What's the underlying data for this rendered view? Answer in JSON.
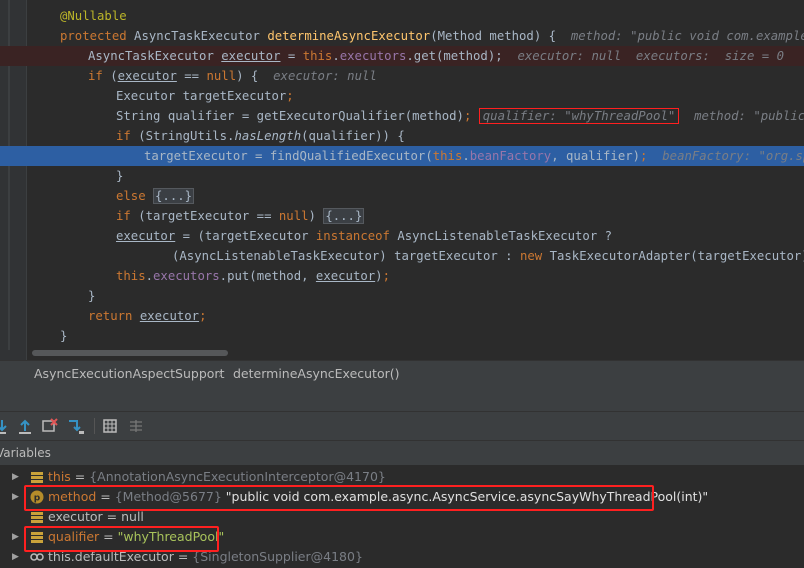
{
  "editor": {
    "lines": [
      {
        "parts": [
          {
            "t": "@Nullable",
            "c": "ann"
          }
        ]
      },
      {
        "parts": [
          {
            "t": "protected ",
            "c": "kw"
          },
          {
            "t": "AsyncTaskExecutor "
          },
          {
            "t": "determineAsyncExecutor",
            "c": "fn"
          },
          {
            "t": "(Method method) {  "
          },
          {
            "t": "method: \"public void com.example.async.AsyncService.asyncSayWhyThreadPool(int)\"",
            "c": "inlay"
          }
        ]
      },
      {
        "parts": [
          {
            "t": "AsyncTaskExecutor "
          },
          {
            "t": "executor",
            "c": "var-ul"
          },
          {
            "t": " = "
          },
          {
            "t": "this",
            "c": "kw"
          },
          {
            "t": "."
          },
          {
            "t": "executors",
            "c": "field"
          },
          {
            "t": ".get(method);  "
          },
          {
            "t": "executor: null  executors:  size = 0",
            "c": "inlay"
          }
        ]
      },
      {
        "parts": [
          {
            "t": "if ",
            "c": "kw"
          },
          {
            "t": "("
          },
          {
            "t": "executor",
            "c": "var-ul"
          },
          {
            "t": " == "
          },
          {
            "t": "null",
            "c": "kw"
          },
          {
            "t": ") {  "
          },
          {
            "t": "executor: null",
            "c": "inlay"
          }
        ]
      },
      {
        "parts": [
          {
            "t": "Executor targetExecutor"
          },
          {
            "t": ";",
            "c": "kw"
          }
        ]
      },
      {
        "parts": [
          {
            "t": "String qualifier = getExecutorQualifier(method)"
          },
          {
            "t": ";",
            "c": "kw"
          },
          {
            "t": " "
          },
          {
            "t": "qualifier: \"whyThreadPool\"",
            "c": "inlay boxed"
          },
          {
            "t": "  "
          },
          {
            "t": "method: \"public void com.example.async.AsyncService.asyncSayWhyThreadPool(int)\"",
            "c": "inlay"
          }
        ]
      },
      {
        "parts": [
          {
            "t": "if ",
            "c": "kw"
          },
          {
            "t": "(StringUtils."
          },
          {
            "t": "hasLength",
            "c": "static-i"
          },
          {
            "t": "(qualifier)) {"
          }
        ]
      },
      {
        "parts": [
          {
            "t": "targetExecutor = findQualifiedExecutor("
          },
          {
            "t": "this",
            "c": "kw"
          },
          {
            "t": "."
          },
          {
            "t": "beanFactory",
            "c": "field"
          },
          {
            "t": ", qualifier)"
          },
          {
            "t": ";",
            "c": "kw"
          },
          {
            "t": "  "
          },
          {
            "t": "beanFactory: \"org.springframework.beans.factory.support.DefaultListableBeanFactory\"",
            "c": "inlay"
          }
        ]
      },
      {
        "parts": [
          {
            "t": "}"
          }
        ]
      },
      {
        "parts": [
          {
            "t": "else ",
            "c": "kw"
          },
          {
            "t": "{...}",
            "c": "fold"
          }
        ]
      },
      {
        "parts": [
          {
            "t": "if ",
            "c": "kw"
          },
          {
            "t": "(targetExecutor == "
          },
          {
            "t": "null",
            "c": "kw"
          },
          {
            "t": ") "
          },
          {
            "t": "{...}",
            "c": "fold"
          }
        ]
      },
      {
        "parts": [
          {
            "t": "executor",
            "c": "var-ul"
          },
          {
            "t": " = (targetExecutor "
          },
          {
            "t": "instanceof ",
            "c": "kw"
          },
          {
            "t": "AsyncListenableTaskExecutor ?"
          }
        ]
      },
      {
        "parts": [
          {
            "t": "(AsyncListenableTaskExecutor) targetExecutor : "
          },
          {
            "t": "new ",
            "c": "kw"
          },
          {
            "t": "TaskExecutorAdapter(targetExecutor))"
          },
          {
            "t": ";",
            "c": "kw"
          }
        ]
      },
      {
        "parts": [
          {
            "t": "this",
            "c": "kw"
          },
          {
            "t": "."
          },
          {
            "t": "executors",
            "c": "field"
          },
          {
            "t": ".put(method, "
          },
          {
            "t": "executor",
            "c": "var-ul"
          },
          {
            "t": ")"
          },
          {
            "t": ";",
            "c": "kw"
          }
        ]
      },
      {
        "parts": [
          {
            "t": "}"
          }
        ]
      },
      {
        "parts": [
          {
            "t": "return ",
            "c": "kw"
          },
          {
            "t": "executor",
            "c": "var-ul"
          },
          {
            "t": ";",
            "c": "kw"
          }
        ]
      },
      {
        "parts": [
          {
            "t": "}"
          }
        ]
      }
    ]
  },
  "breadcrumb": {
    "class_name": "AsyncExecutionAspectSupport",
    "separator": "›",
    "method_name": "determineAsyncExecutor()"
  },
  "debug": {
    "variables_header": "Variables",
    "variables": [
      {
        "name": "this",
        "eq": " = ",
        "type": "{AnnotationAsyncExecutionInterceptor@4170}",
        "value": "",
        "icon": "field-icon",
        "expandable": true,
        "name_plain": false
      },
      {
        "name": "method",
        "eq": " = ",
        "type": "{Method@5677}",
        "value": " \"public void com.example.async.AsyncService.asyncSayWhyThreadPool(int)\"",
        "icon": "parameter-icon",
        "expandable": true,
        "name_plain": false
      },
      {
        "name": "executor",
        "eq": " = ",
        "type": "",
        "value": "null",
        "icon": "field-icon",
        "expandable": false,
        "name_plain": true
      },
      {
        "name": "qualifier",
        "eq": " = ",
        "type": "",
        "value": "\"whyThreadPool\"",
        "icon": "field-icon",
        "expandable": true,
        "name_plain": false
      },
      {
        "name": "this.defaultExecutor",
        "eq": " = ",
        "type": "{SingletonSupplier@4180}",
        "value": "",
        "icon": "watch-icon",
        "expandable": true,
        "name_plain": true
      }
    ]
  },
  "colors": {
    "error_line": "#3a2323",
    "current_line": "#2d5fa3",
    "highlight_box": "#ff2020"
  }
}
